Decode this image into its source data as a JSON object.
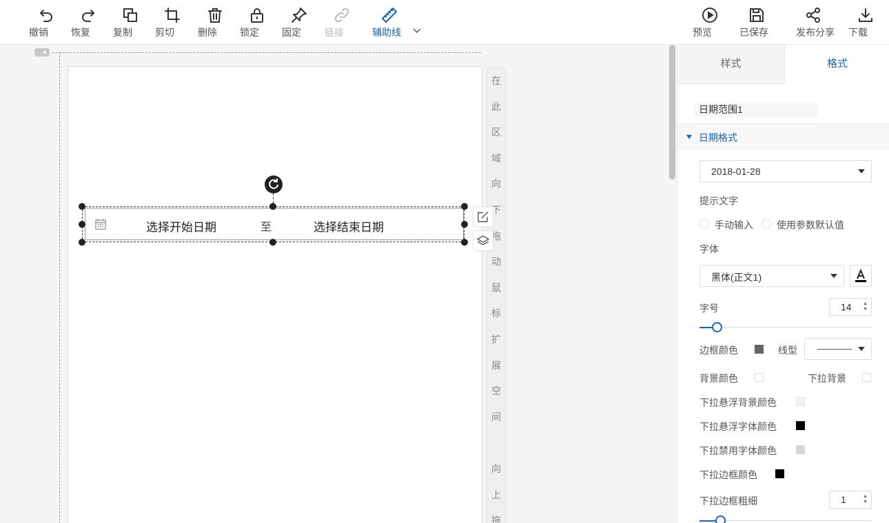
{
  "toolbar": {
    "undo": "撤销",
    "redo": "恢复",
    "copy": "复制",
    "cut": "剪切",
    "delete": "删除",
    "lock": "锁定",
    "pin": "固定",
    "link": "链接",
    "guides": "辅助线",
    "preview": "预览",
    "saved": "已保存",
    "publish": "发布分享",
    "download": "下载",
    "accent_color": "#1565c0"
  },
  "canvas": {
    "drag_hint_chars": [
      "在",
      "此",
      "区",
      "域",
      "向",
      "下",
      "拖",
      "动",
      "鼠",
      "标",
      "扩",
      "展",
      "空",
      "间",
      "",
      "向",
      "上",
      "拖"
    ],
    "date_widget": {
      "start_placeholder": "选择开始日期",
      "separator": "至",
      "end_placeholder": "选择结束日期",
      "icon": "calendar-icon"
    }
  },
  "panel": {
    "tabs": [
      {
        "label": "样式",
        "active": false
      },
      {
        "label": "格式",
        "active": true
      }
    ],
    "component_name": "日期范围1",
    "section_title": "日期格式",
    "date_format_value": "2018-01-28",
    "hint_text_label": "提示文字",
    "hint_options": [
      "手动输入",
      "使用参数默认值"
    ],
    "font_label": "字体",
    "font_value": "黑体(正文1)",
    "font_size_label": "字号",
    "font_size_value": "14",
    "font_size_slider_fraction": 0.1,
    "border_color_label": "边框颜色",
    "border_color": "#666666",
    "line_style_label": "线型",
    "bg_color_label": "背景颜色",
    "bg_color": "#ffffff",
    "dropdown_bg_label": "下拉背景",
    "dropdown_bg": "#ffffff",
    "dropdown_hover_bg_label": "下拉悬浮背景颜色",
    "dropdown_hover_bg": "#f2f2f2",
    "dropdown_hover_font_label": "下拉悬浮字体颜色",
    "dropdown_hover_font": "#000000",
    "dropdown_disabled_font_label": "下拉禁用字体颜色",
    "dropdown_disabled_font": "#d6d6d6",
    "dropdown_border_color_label": "下拉边框颜色",
    "dropdown_border_color": "#000000",
    "dropdown_border_width_label": "下拉边框粗细",
    "dropdown_border_width_value": "1",
    "dropdown_border_width_slider_fraction": 0.12
  }
}
